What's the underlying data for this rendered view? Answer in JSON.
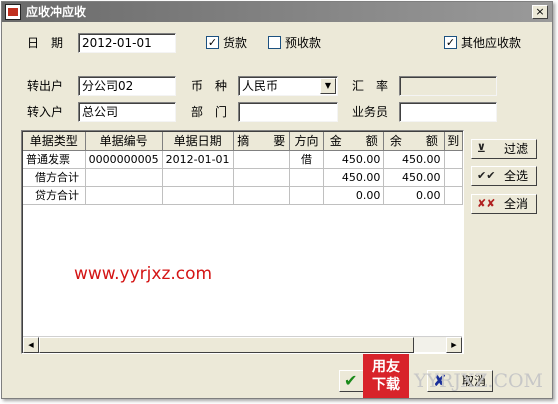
{
  "window": {
    "title": "应收冲应收",
    "close_glyph": "×"
  },
  "date": {
    "label": "日　期",
    "value": "2012-01-01"
  },
  "checkboxes": [
    {
      "label": "货款",
      "checked": true
    },
    {
      "label": "预收款",
      "checked": false
    },
    {
      "label": "其他应收款",
      "checked": true
    }
  ],
  "form": {
    "out_label": "转出户",
    "out_value": "分公司02",
    "currency_label": "币　种",
    "currency_value": "人民币",
    "rate_label": "汇　率",
    "rate_value": "",
    "in_label": "转入户",
    "in_value": "总公司",
    "dept_label": "部　门",
    "dept_value": "",
    "staff_label": "业务员",
    "staff_value": ""
  },
  "table": {
    "columns": [
      "单据类型",
      "单据编号",
      "单据日期",
      "摘　　要",
      "方向",
      "金　　额",
      "余　　额",
      "到"
    ],
    "rows": [
      [
        "普通发票",
        "0000000005",
        "2012-01-01",
        "",
        "借",
        "450.00",
        "450.00",
        ""
      ],
      [
        "借方合计",
        "",
        "",
        "",
        "",
        "450.00",
        "450.00",
        ""
      ],
      [
        "贷方合计",
        "",
        "",
        "",
        "",
        "0.00",
        "0.00",
        ""
      ]
    ]
  },
  "side_buttons": [
    {
      "label": "过滤",
      "icon": "filter-icon",
      "glyph": "⊻"
    },
    {
      "label": "全选",
      "icon": "select-all-icon",
      "glyph": "✔✔"
    },
    {
      "label": "全消",
      "icon": "clear-all-icon",
      "glyph": "✘✘"
    }
  ],
  "watermark_url": "www.yyrjxz.com",
  "bottom": {
    "ok_label": "确定",
    "cancel_label": "取消"
  },
  "logo": {
    "line1": "用友",
    "line2": "下载"
  },
  "brand_text": "YYRJXZ.COM",
  "colors": {
    "title_bar": "#7b7b7b",
    "face": "#ece9d8",
    "watermark": "#d41414",
    "logo": "#d8232a"
  }
}
